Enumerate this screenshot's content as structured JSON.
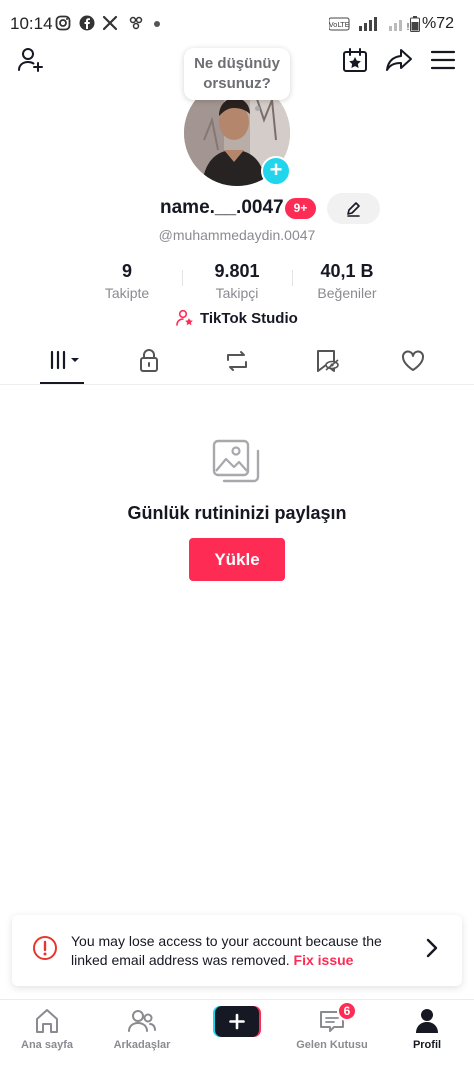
{
  "status_bar": {
    "time": "10:14",
    "network": "VoLTE 4.5G",
    "battery": "%72"
  },
  "profile": {
    "bubble_text_line1": "Ne düşünüy",
    "bubble_text_line2": "orsunuz?",
    "username": "name.__.0047",
    "notification_count": "9+",
    "handle": "@muhammedaydin.0047",
    "stats": {
      "following_count": "9",
      "following_label": "Takipte",
      "followers_count": "9.801",
      "followers_label": "Takipçi",
      "likes_count": "40,1 B",
      "likes_label": "Beğeniler"
    },
    "studio_label": "TikTok Studio"
  },
  "tabs": [
    {
      "name": "videos-grid",
      "icon": "grid-columns-icon"
    },
    {
      "name": "private",
      "icon": "lock-icon"
    },
    {
      "name": "reposts",
      "icon": "repost-icon"
    },
    {
      "name": "favorites-hidden",
      "icon": "bookmark-hidden-icon"
    },
    {
      "name": "liked",
      "icon": "heart-icon"
    }
  ],
  "empty_state": {
    "title": "Günlük rutininizi paylaşın",
    "button": "Yükle"
  },
  "warning_banner": {
    "message": "You may lose access to your account because the linked email address was removed.",
    "link": "Fix issue"
  },
  "bottom_nav": {
    "home": "Ana sayfa",
    "friends": "Arkadaşlar",
    "inbox": "Gelen Kutusu",
    "inbox_badge": "6",
    "profile": "Profil"
  },
  "colors": {
    "accent": "#fe2c55",
    "cyan": "#20d5ec",
    "text": "#161823",
    "muted": "#8a8b91"
  }
}
